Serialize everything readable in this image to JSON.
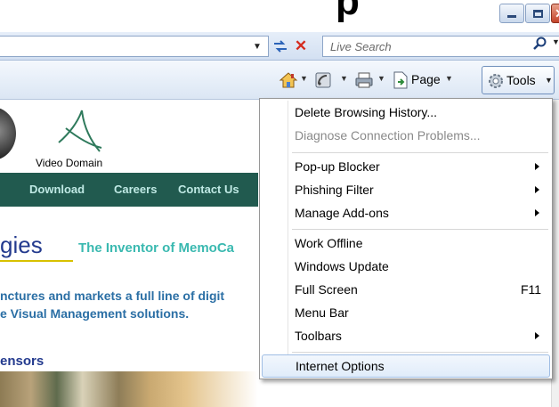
{
  "window": {
    "title_fragment": "p",
    "minimize_icon": "minimize-icon",
    "maximize_icon": "maximize-icon",
    "close_icon": "close-icon"
  },
  "address_bar": {
    "url": "",
    "refresh_icon": "refresh-icon",
    "stop_icon": "stop-icon"
  },
  "search": {
    "placeholder": "Live Search",
    "search_icon": "search-icon"
  },
  "command_bar": {
    "home_icon": "home-icon",
    "feeds_icon": "feeds-icon",
    "print_icon": "print-icon",
    "page_label": "Page",
    "tools_label": "Tools"
  },
  "web_content": {
    "logo_caption": "Video Domain",
    "nav": [
      "Download",
      "Careers",
      "Contact Us"
    ],
    "headline_fragment": "gies",
    "tagline": "The Inventor of MemoCa",
    "body_lines": [
      "nctures and markets a full line of digit",
      "e Visual Management solutions."
    ],
    "sensors_heading": "ensors"
  },
  "tools_menu": {
    "items": [
      {
        "label": "Delete Browsing History...",
        "enabled": true
      },
      {
        "label": "Diagnose Connection Problems...",
        "enabled": false
      },
      {
        "label": "Pop-up Blocker",
        "submenu": true
      },
      {
        "label": "Phishing Filter",
        "submenu": true
      },
      {
        "label": "Manage Add-ons",
        "submenu": true
      },
      {
        "label": "Work Offline"
      },
      {
        "label": "Windows Update"
      },
      {
        "label": "Full Screen",
        "shortcut": "F11"
      },
      {
        "label": "Menu Bar"
      },
      {
        "label": "Toolbars",
        "submenu": true
      },
      {
        "label": "Internet Options",
        "highlighted": true
      }
    ]
  },
  "colors": {
    "nav_bg": "#215a4f",
    "nav_text": "#bfe9e4",
    "tagline": "#3ab9b0",
    "body_text": "#2b6fa5",
    "menu_highlight": "#e0ecfa"
  }
}
